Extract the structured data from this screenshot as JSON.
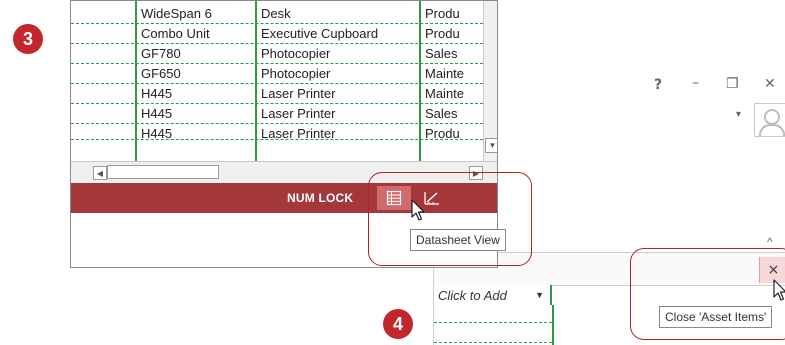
{
  "steps": {
    "left": "3",
    "right": "4"
  },
  "datasheet": {
    "rows": [
      [
        "WideSpan 6",
        "Desk",
        "Produ"
      ],
      [
        "Combo Unit",
        "Executive Cupboard",
        "Produ"
      ],
      [
        "GF780",
        "Photocopier",
        "Sales"
      ],
      [
        "GF650",
        "Photocopier",
        "Mainte"
      ],
      [
        "H445",
        "Laser Printer",
        "Mainte"
      ],
      [
        "H445",
        "Laser Printer",
        "Sales"
      ],
      [
        "H445",
        "Laser Printer",
        "Produ"
      ]
    ]
  },
  "statusbar": {
    "num_lock": "NUM LOCK"
  },
  "tooltips": {
    "datasheet_view": "Datasheet View",
    "close_tab": "Close 'Asset Items'"
  },
  "window": {
    "help": "?",
    "minimize": "–",
    "restore": "❐",
    "close": "✕",
    "collapse": "^"
  },
  "grid": {
    "click_to_add": "Click to Add"
  },
  "icons": {
    "datasheet_view": "table-icon",
    "design_view": "design-ruler-icon",
    "avatar": "user-avatar-icon",
    "cursor": "mouse-pointer-icon",
    "close": "close-icon"
  },
  "colors": {
    "accent": "#a4373a",
    "callout": "#b0232a",
    "grid_line": "#2a9b3f",
    "badge": "#c1272d",
    "active_view_button": "#d06a6c",
    "close_hover": "#f7d7d7"
  }
}
